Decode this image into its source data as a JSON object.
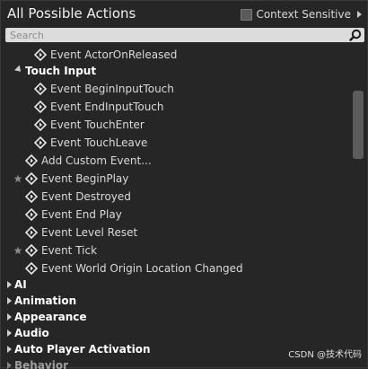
{
  "header": {
    "title": "All Possible Actions",
    "context_sensitive_label": "Context Sensitive"
  },
  "search": {
    "placeholder": "Search"
  },
  "actions": {
    "touch_input_category": "Touch Input",
    "event_actor_on_released": "Event ActorOnReleased",
    "event_begin_input_touch": "Event BeginInputTouch",
    "event_end_input_touch": "Event EndInputTouch",
    "event_touch_enter": "Event TouchEnter",
    "event_touch_leave": "Event TouchLeave",
    "add_custom_event": "Add Custom Event...",
    "event_begin_play": "Event BeginPlay",
    "event_destroyed": "Event Destroyed",
    "event_end_play": "Event End Play",
    "event_level_reset": "Event Level Reset",
    "event_tick": "Event Tick",
    "event_world_origin": "Event World Origin Location Changed"
  },
  "categories": {
    "ai": "AI",
    "animation": "Animation",
    "appearance": "Appearance",
    "audio": "Audio",
    "auto_player_activation": "Auto Player Activation",
    "behavior": "Behavior"
  },
  "watermark": "CSDN @技术代码",
  "icons": {
    "event": "diamond-arrow-icon",
    "favorite": "star-icon",
    "search": "magnifier-icon"
  }
}
